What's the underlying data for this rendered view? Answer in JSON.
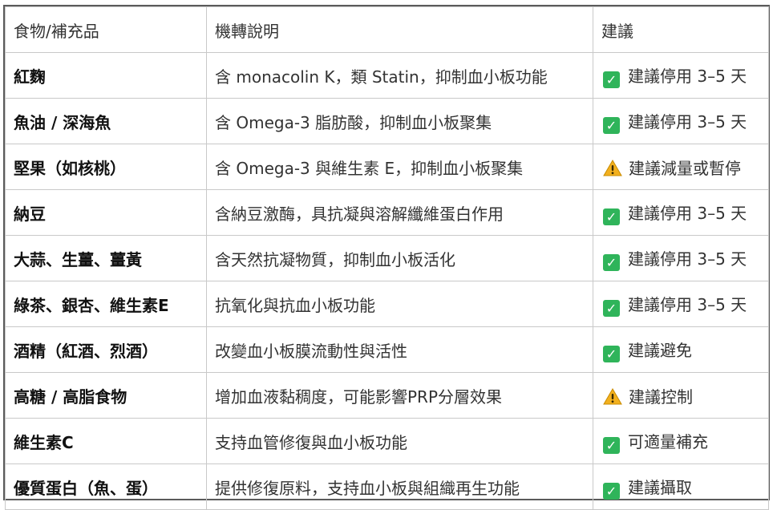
{
  "headers": [
    "食物/補充品",
    "機轉說明",
    "建議"
  ],
  "rows": [
    {
      "food": "紅麴",
      "mechanism": "含 monacolin K，類 Statin，抑制血小板功能",
      "icon": "check-icon",
      "recommendation": "建議停用 3–5 天"
    },
    {
      "food": "魚油 / 深海魚",
      "mechanism": "含 Omega-3 脂肪酸，抑制血小板聚集",
      "icon": "check-icon",
      "recommendation": "建議停用 3–5 天"
    },
    {
      "food": "堅果（如核桃）",
      "mechanism": "含 Omega-3 與維生素 E，抑制血小板聚集",
      "icon": "warning-icon",
      "recommendation": "建議減量或暫停"
    },
    {
      "food": "納豆",
      "mechanism": "含納豆激酶，具抗凝與溶解纖維蛋白作用",
      "icon": "check-icon",
      "recommendation": "建議停用 3–5 天"
    },
    {
      "food": "大蒜、生薑、薑黃",
      "mechanism": "含天然抗凝物質，抑制血小板活化",
      "icon": "check-icon",
      "recommendation": "建議停用 3–5 天"
    },
    {
      "food": "綠茶、銀杏、維生素E",
      "mechanism": "抗氧化與抗血小板功能",
      "icon": "check-icon",
      "recommendation": "建議停用 3–5 天"
    },
    {
      "food": "酒精（紅酒、烈酒）",
      "mechanism": "改變血小板膜流動性與活性",
      "icon": "check-icon",
      "recommendation": "建議避免"
    },
    {
      "food": "高糖 / 高脂食物",
      "mechanism": "增加血液黏稠度，可能影響PRP分層效果",
      "icon": "warning-icon",
      "recommendation": "建議控制"
    },
    {
      "food": "維生素C",
      "mechanism": "支持血管修復與血小板功能",
      "icon": "check-icon",
      "recommendation": "可適量補充"
    },
    {
      "food": "優質蛋白（魚、蛋）",
      "mechanism": "提供修復原料，支持血小板與組織再生功能",
      "icon": "check-icon",
      "recommendation": "建議攝取"
    }
  ],
  "colors": {
    "check": "#2fb45a",
    "warning": "#f2b01e",
    "border": "#c9c9c9",
    "frame": "#5b5b5b"
  }
}
